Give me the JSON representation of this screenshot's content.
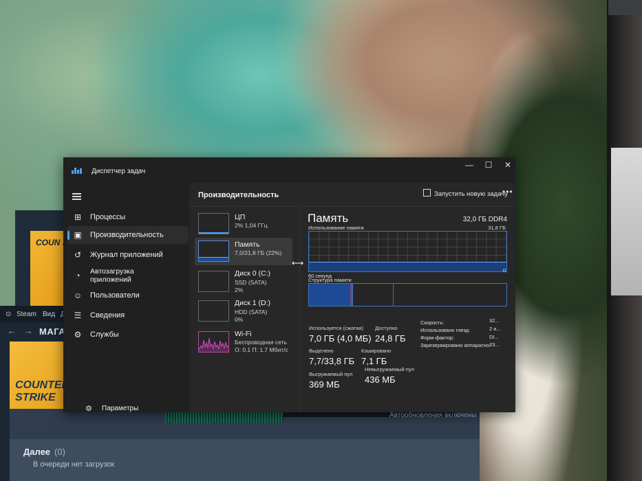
{
  "taskmanager": {
    "title": "Диспетчер задач",
    "window_controls": [
      "—",
      "☐",
      "✕"
    ],
    "nav": [
      {
        "label": "Процессы",
        "icon": "grid-icon"
      },
      {
        "label": "Производительность",
        "icon": "performance-icon"
      },
      {
        "label": "Журнал приложений",
        "icon": "history-icon"
      },
      {
        "label": "Автозагрузка приложений",
        "icon": "startup-icon"
      },
      {
        "label": "Пользователи",
        "icon": "users-icon"
      },
      {
        "label": "Сведения",
        "icon": "list-icon"
      },
      {
        "label": "Службы",
        "icon": "services-icon"
      }
    ],
    "settings_label": "Параметры",
    "main_title": "Производительность",
    "run_task_label": "Запустить новую задачу",
    "more_label": "•••",
    "devices": [
      {
        "name": "ЦП",
        "line1": "2% 1,04 ГГц",
        "line2": ""
      },
      {
        "name": "Память",
        "line1": "7,0/31,8 ГБ (22%)",
        "line2": ""
      },
      {
        "name": "Диск 0 (C:)",
        "line1": "SSD (SATA)",
        "line2": "2%"
      },
      {
        "name": "Диск 1 (D:)",
        "line1": "HDD (SATA)",
        "line2": "0%"
      },
      {
        "name": "Wi-Fi",
        "line1": "Беспроводная сеть",
        "line2": "О: 0,1 П: 1,7 Мбит/с"
      }
    ],
    "memory": {
      "title": "Память",
      "type": "32,0 ГБ DDR4",
      "usage_label": "Использование памяти",
      "usage_max": "31,8 ГБ",
      "usage_min": "0",
      "time_label": "60 секунд",
      "usage_fraction": 0.22,
      "structure_label": "Структура памяти",
      "structure_used_fraction": 0.22,
      "structure_standby_fraction": 0.2,
      "stats": {
        "in_use_label": "Используется (сжатая)",
        "in_use_value": "7,0 ГБ (4,0 МБ)",
        "available_label": "Доступно",
        "available_value": "24,8 ГБ",
        "committed_label": "Выделено",
        "committed_value": "7,7/33,8 ГБ",
        "cached_label": "Кэшировано",
        "cached_value": "7,1 ГБ",
        "paged_label": "Выгружаемый пул",
        "paged_value": "369 МБ",
        "nonpaged_label": "Невыгружаемый пул",
        "nonpaged_value": "436 МБ"
      },
      "details": [
        {
          "label": "Скорость:",
          "value": "32..."
        },
        {
          "label": "Использовано гнезд:",
          "value": "2 и..."
        },
        {
          "label": "Форм-фактор:",
          "value": "DI..."
        },
        {
          "label": "Зарезервировано аппаратно:",
          "value": "23..."
        }
      ]
    },
    "colors": {
      "accent": "#4ba3ff",
      "mem_fill": "#1a3f7a",
      "wifi_line": "#d04fbf"
    }
  },
  "steam": {
    "menu": [
      "Steam",
      "Вид",
      "Др"
    ],
    "store_label": "МАГАЗ",
    "game_title": "COUNTER STRIKE",
    "cover_text": "COUN STR",
    "auto_updates": "Автообновления включены",
    "next_label": "Далее",
    "next_count": "(0)",
    "queue_empty": "В очереди нет загрузок"
  }
}
